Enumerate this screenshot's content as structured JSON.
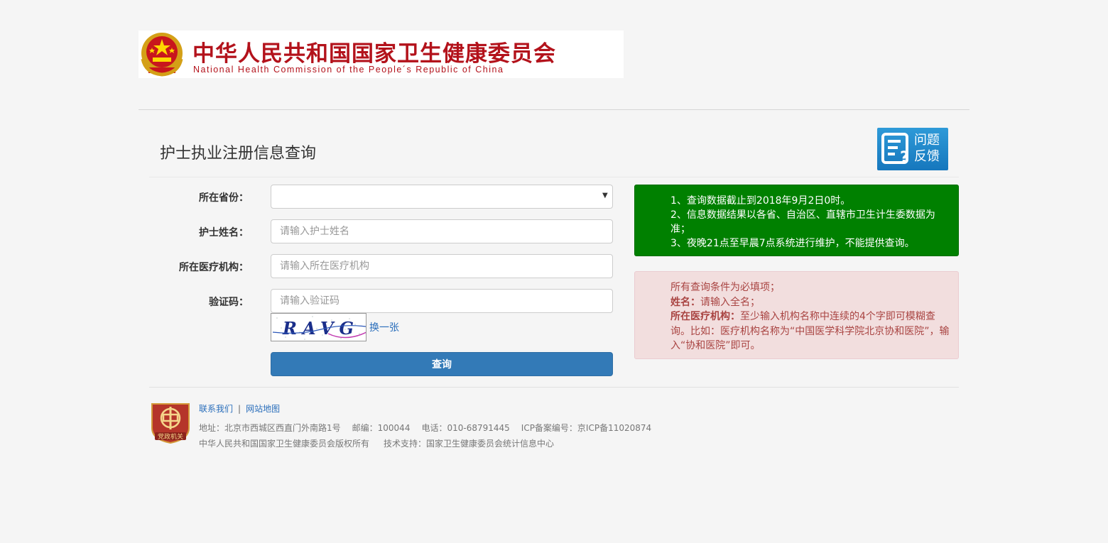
{
  "header": {
    "org_name_cn": "中华人民共和国国家卫生健康委员会",
    "org_name_en": "National Health Commission of the People´s Republic of China"
  },
  "page": {
    "title": "护士执业注册信息查询",
    "feedback_label": "问题反馈"
  },
  "form": {
    "province_label": "所在省份：",
    "province_value": "",
    "name_label": "护士姓名：",
    "name_placeholder": "请输入护士姓名",
    "institution_label": "所在医疗机构：",
    "institution_placeholder": "请输入所在医疗机构",
    "captcha_label": "验证码：",
    "captcha_placeholder": "请输入验证码",
    "captcha_text": "RAVG",
    "refresh_label": "换一张",
    "submit_label": "查询"
  },
  "notices": {
    "info": [
      "1、查询数据截止到2018年9月2日0时。",
      "2、信息数据结果以各省、自治区、直辖市卫生计生委数据为准；",
      "3、夜晚21点至早晨7点系统进行维护，不能提供查询。"
    ],
    "warning": {
      "line1": "所有查询条件为必填项；",
      "name_key": "姓名：",
      "name_text": "请输入全名；",
      "inst_key": "所在医疗机构：",
      "inst_text": "至少输入机构名称中连续的4个字即可模糊查询。比如：医疗机构名称为“中国医学科学院北京协和医院”，输入“协和医院”即可。"
    }
  },
  "footer": {
    "badge_text": "党政机关",
    "link_contact": "联系我们",
    "separator": "|",
    "link_sitemap": "网站地图",
    "address": "地址：北京市西城区西直门外南路1号",
    "postcode": "邮编：100044",
    "phone": "电话：010-68791445",
    "icp": "ICP备案编号：京ICP备11020874",
    "copyright": "中华人民共和国国家卫生健康委员会版权所有",
    "tech_support": "技术支持：国家卫生健康委员会统计信息中心"
  },
  "colors": {
    "brand_red": "#b3121b",
    "primary_blue": "#337ab7",
    "notice_green": "#008000",
    "notice_red_bg": "#f2dede",
    "notice_red_text": "#a94442"
  },
  "icons": [
    "national-emblem-icon",
    "feedback-icon",
    "dropdown-arrow-icon",
    "party-government-badge-icon"
  ]
}
